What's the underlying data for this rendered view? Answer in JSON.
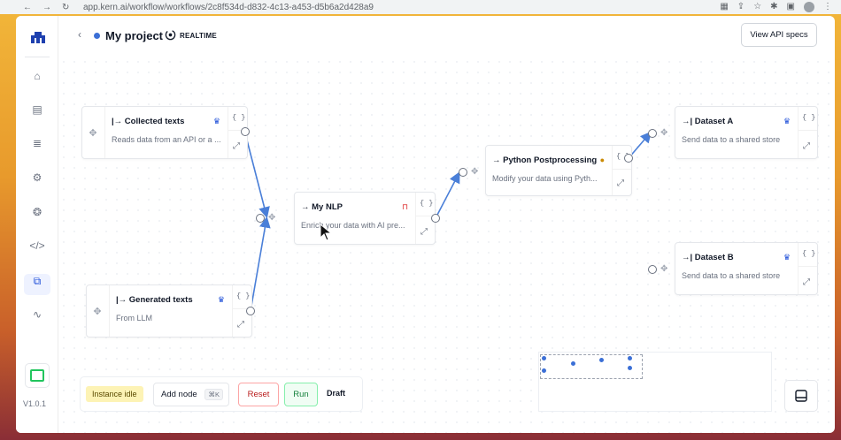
{
  "browser": {
    "url": "app.kern.ai/workflow/workflows/2c8f534d-d832-4c13-a453-d5b6a2d428a9"
  },
  "sidebar": {
    "items": [
      {
        "icon": "home-icon"
      },
      {
        "icon": "id-card-icon"
      },
      {
        "icon": "database-icon"
      },
      {
        "icon": "settings-icon"
      },
      {
        "icon": "brain-icon"
      },
      {
        "icon": "code-icon"
      },
      {
        "icon": "workflow-icon"
      },
      {
        "icon": "pulse-icon"
      }
    ],
    "version": "V1.0.1"
  },
  "header": {
    "title": "My project",
    "mode": "REALTIME",
    "api_button": "View API specs"
  },
  "nodes": {
    "collected": {
      "title": "|→ Collected texts",
      "desc": "Reads data from an API or a ...",
      "braces": "{ }"
    },
    "generated": {
      "title": "|→ Generated texts",
      "desc": "From LLM",
      "braces": "{ }"
    },
    "nlp": {
      "title": "→ My NLP",
      "desc": "Enrich your data with AI pre...",
      "braces": "{ }"
    },
    "python": {
      "title": "→ Python Postprocessing",
      "desc": "Modify your data using Pyth...",
      "braces": "{ }"
    },
    "datasetA": {
      "title": "→| Dataset A",
      "desc": "Send data to a shared store",
      "braces": "{ }"
    },
    "datasetB": {
      "title": "→| Dataset B",
      "desc": "Send data to a shared store",
      "braces": "{ }"
    }
  },
  "toolbar": {
    "status": "Instance idle",
    "add_node": "Add node",
    "add_node_shortcut": "⌘K",
    "reset": "Reset",
    "run": "Run",
    "draft": "Draft"
  },
  "colors": {
    "accent": "#3b6fd6",
    "edge": "#4a7fd8",
    "idle": "#fdf3b5",
    "reset": "#b91c1c",
    "run": "#15803d"
  }
}
